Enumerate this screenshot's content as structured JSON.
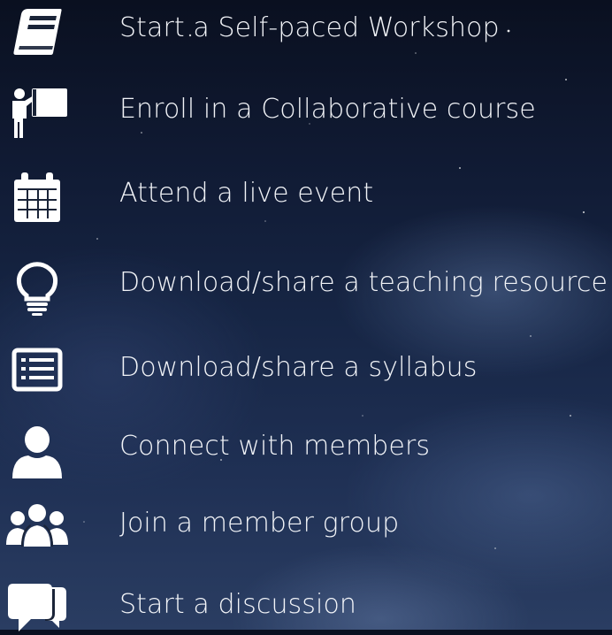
{
  "menu": {
    "items": [
      {
        "icon": "book-icon",
        "label": "Start a Self-paced Workshop"
      },
      {
        "icon": "presenter-whiteboard-icon",
        "label": "Enroll in a Collaborative course"
      },
      {
        "icon": "calendar-icon",
        "label": "Attend a live event"
      },
      {
        "icon": "lightbulb-icon",
        "label": "Download/share a teaching resource"
      },
      {
        "icon": "syllabus-list-icon",
        "label": "Download/share a syllabus"
      },
      {
        "icon": "person-icon",
        "label": "Connect with members"
      },
      {
        "icon": "group-icon",
        "label": "Join a member group"
      },
      {
        "icon": "chat-bubbles-icon",
        "label": "Start a discussion"
      }
    ]
  },
  "colors": {
    "text": "#f2f4f8",
    "icon": "#ffffff"
  }
}
